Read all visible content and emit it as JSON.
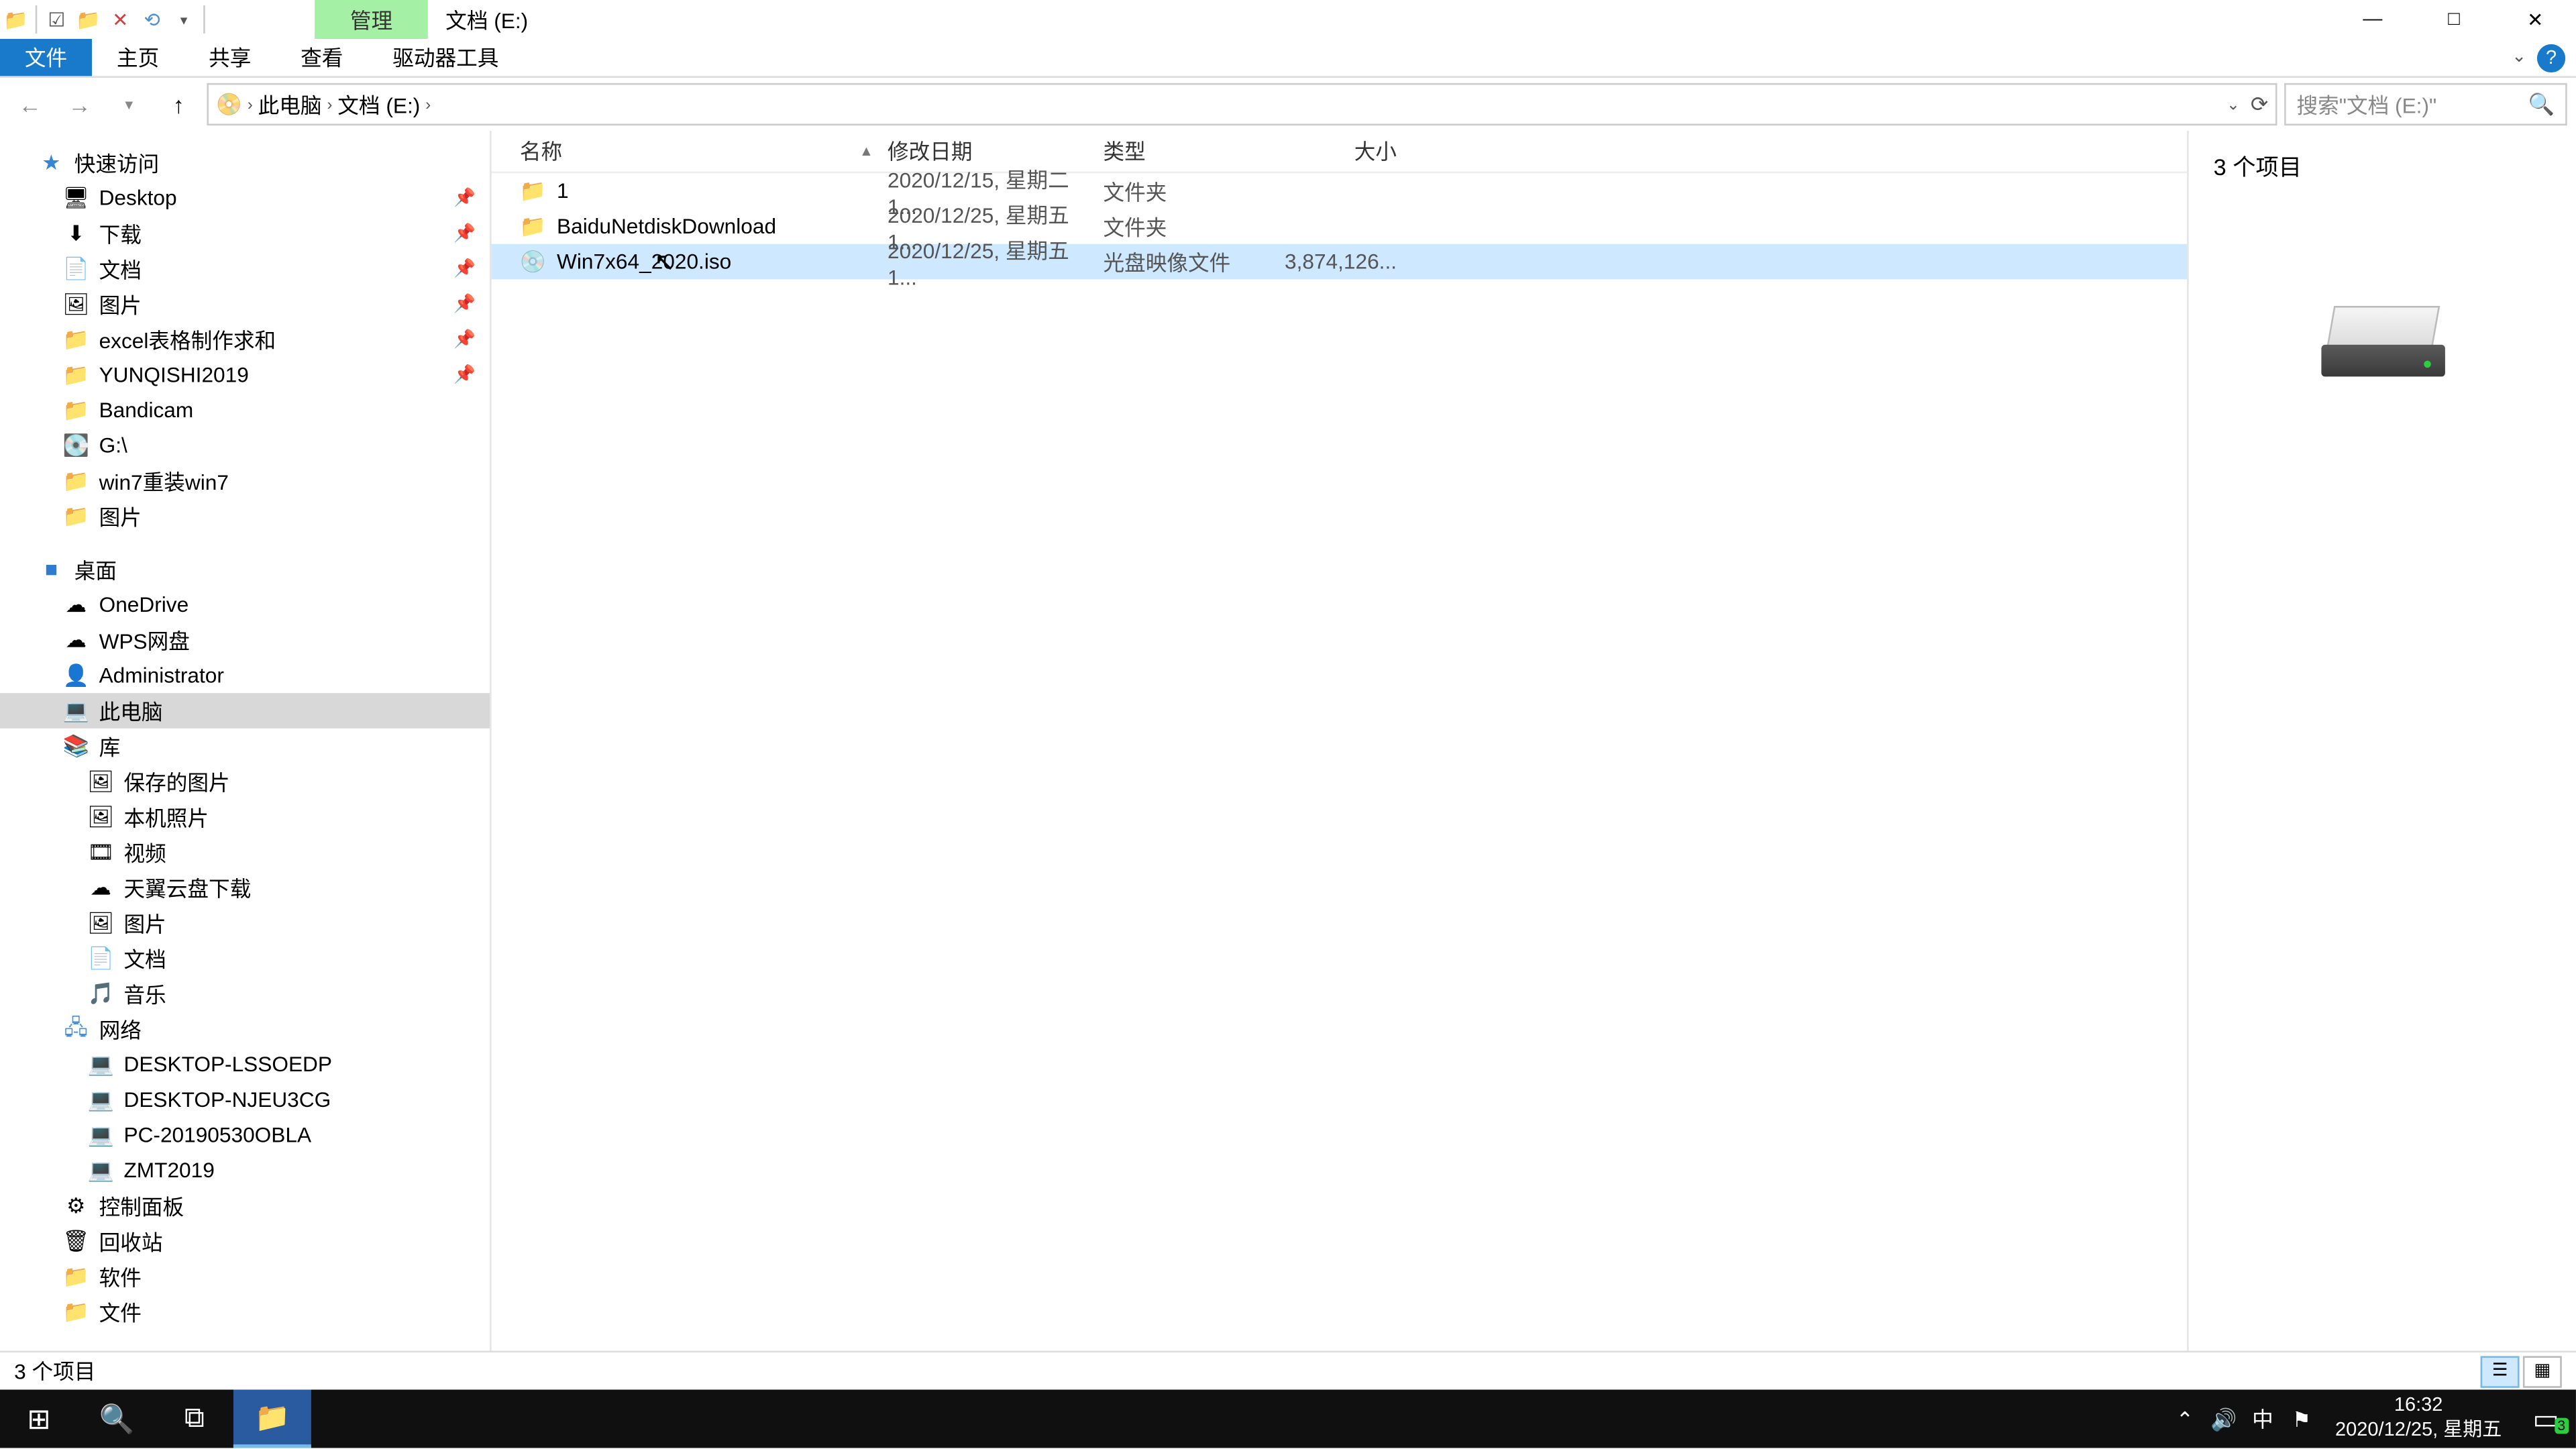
{
  "titlebar": {
    "context_tab": "管理",
    "title": "文档 (E:)"
  },
  "window_controls": {
    "min": "—",
    "max": "□",
    "close": "✕"
  },
  "ribbon": {
    "file": "文件",
    "tabs": [
      "主页",
      "共享",
      "查看",
      "驱动器工具"
    ]
  },
  "breadcrumb": {
    "segs": [
      "此电脑",
      "文档 (E:)"
    ]
  },
  "search": {
    "placeholder": "搜索\"文档 (E:)\""
  },
  "tree": {
    "quick_access": "快速访问",
    "quick": [
      {
        "label": "Desktop",
        "ico": "🖥",
        "pin": true
      },
      {
        "label": "下载",
        "ico": "⬇",
        "pin": true
      },
      {
        "label": "文档",
        "ico": "📄",
        "pin": true
      },
      {
        "label": "图片",
        "ico": "🖼",
        "pin": true
      },
      {
        "label": "excel表格制作求和",
        "ico": "📁",
        "pin": true
      },
      {
        "label": "YUNQISHI2019",
        "ico": "📁",
        "pin": true
      },
      {
        "label": "Bandicam",
        "ico": "📁",
        "pin": false
      },
      {
        "label": "G:\\",
        "ico": "💽",
        "pin": false
      },
      {
        "label": "win7重装win7",
        "ico": "📁",
        "pin": false
      },
      {
        "label": "图片",
        "ico": "📁",
        "pin": false
      }
    ],
    "desktop": "桌面",
    "desk": [
      {
        "label": "OneDrive",
        "ico": "☁"
      },
      {
        "label": "WPS网盘",
        "ico": "☁"
      },
      {
        "label": "Administrator",
        "ico": "👤"
      },
      {
        "label": "此电脑",
        "ico": "💻",
        "sel": true
      },
      {
        "label": "库",
        "ico": "📚"
      }
    ],
    "libs": [
      {
        "label": "保存的图片",
        "ico": "🖼"
      },
      {
        "label": "本机照片",
        "ico": "🖼"
      },
      {
        "label": "视频",
        "ico": "🎞"
      },
      {
        "label": "天翼云盘下载",
        "ico": "☁"
      },
      {
        "label": "图片",
        "ico": "🖼"
      },
      {
        "label": "文档",
        "ico": "📄"
      },
      {
        "label": "音乐",
        "ico": "🎵"
      }
    ],
    "network": "网络",
    "net": [
      {
        "label": "DESKTOP-LSSOEDP",
        "ico": "💻"
      },
      {
        "label": "DESKTOP-NJEU3CG",
        "ico": "💻"
      },
      {
        "label": "PC-20190530OBLA",
        "ico": "💻"
      },
      {
        "label": "ZMT2019",
        "ico": "💻"
      }
    ],
    "extras": [
      {
        "label": "控制面板",
        "ico": "⚙"
      },
      {
        "label": "回收站",
        "ico": "🗑"
      },
      {
        "label": "软件",
        "ico": "📁"
      },
      {
        "label": "文件",
        "ico": "📁"
      }
    ]
  },
  "columns": {
    "name": "名称",
    "date": "修改日期",
    "type": "类型",
    "size": "大小"
  },
  "rows": [
    {
      "name": "1",
      "date": "2020/12/15, 星期二 1...",
      "type": "文件夹",
      "size": "",
      "ico": "📁",
      "sel": false
    },
    {
      "name": "BaiduNetdiskDownload",
      "date": "2020/12/25, 星期五 1...",
      "type": "文件夹",
      "size": "",
      "ico": "📁",
      "sel": false
    },
    {
      "name": "Win7x64_2020.iso",
      "date": "2020/12/25, 星期五 1...",
      "type": "光盘映像文件",
      "size": "3,874,126...",
      "ico": "💿",
      "sel": true
    }
  ],
  "preview": {
    "count_text": "3 个项目"
  },
  "status": {
    "text": "3 个项目"
  },
  "taskbar": {
    "time": "16:32",
    "date": "2020/12/25, 星期五",
    "ime": "中",
    "notif_count": "3"
  }
}
